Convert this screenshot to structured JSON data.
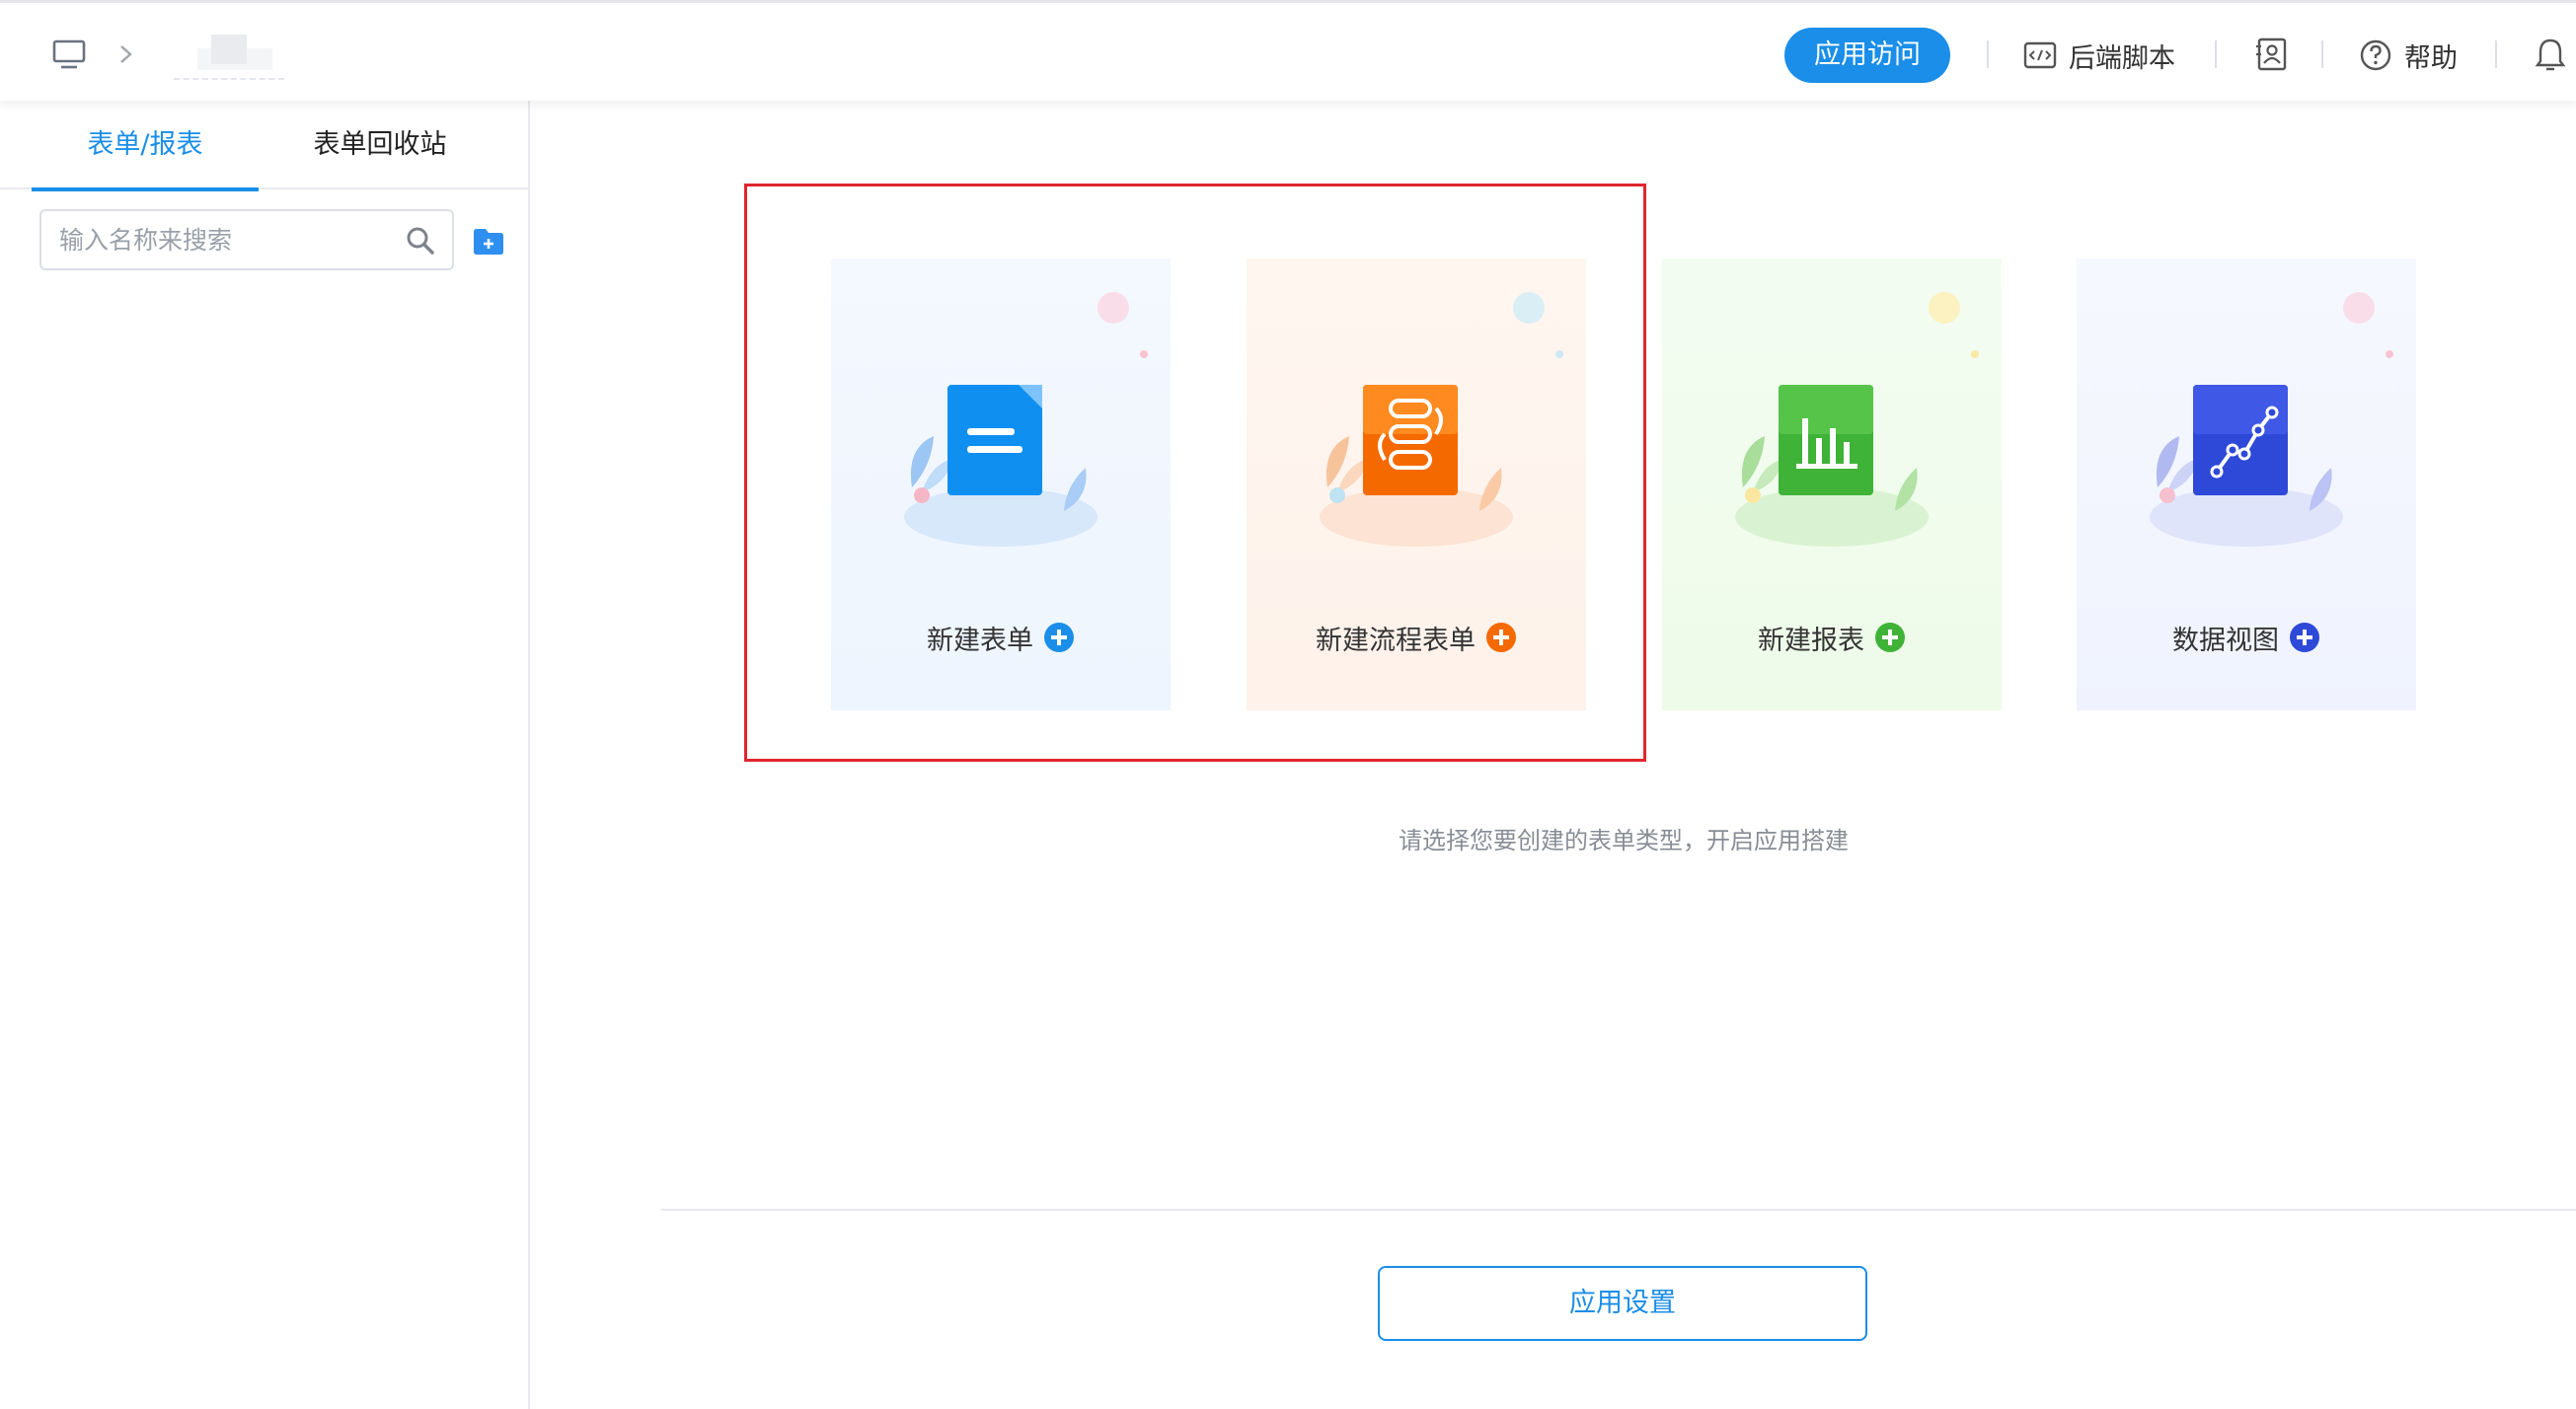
{
  "header": {
    "visit_button": "应用访问",
    "backend_script": "后端脚本",
    "help": "帮助",
    "icons": [
      "monitor-icon",
      "chevron-right-icon",
      "code-icon",
      "contacts-icon",
      "help-icon",
      "bell-icon"
    ]
  },
  "sidebar": {
    "tabs": [
      {
        "label": "表单/报表",
        "active": true
      },
      {
        "label": "表单回收站",
        "active": false
      }
    ],
    "search": {
      "placeholder": "输入名称来搜索",
      "value": ""
    }
  },
  "main": {
    "cards": [
      {
        "label": "新建表单",
        "icon": "document-icon",
        "accent": "#1a8ee8"
      },
      {
        "label": "新建流程表单",
        "icon": "workflow-icon",
        "accent": "#f56a00"
      },
      {
        "label": "新建报表",
        "icon": "bar-chart-icon",
        "accent": "#3fb337"
      },
      {
        "label": "数据视图",
        "icon": "line-chart-icon",
        "accent": "#2e49d8"
      }
    ],
    "hint": "请选择您要创建的表单类型，开启应用搭建",
    "settings_button": "应用设置"
  },
  "colors": {
    "primary": "#1a8ee8",
    "highlight_border": "#e0262f"
  }
}
